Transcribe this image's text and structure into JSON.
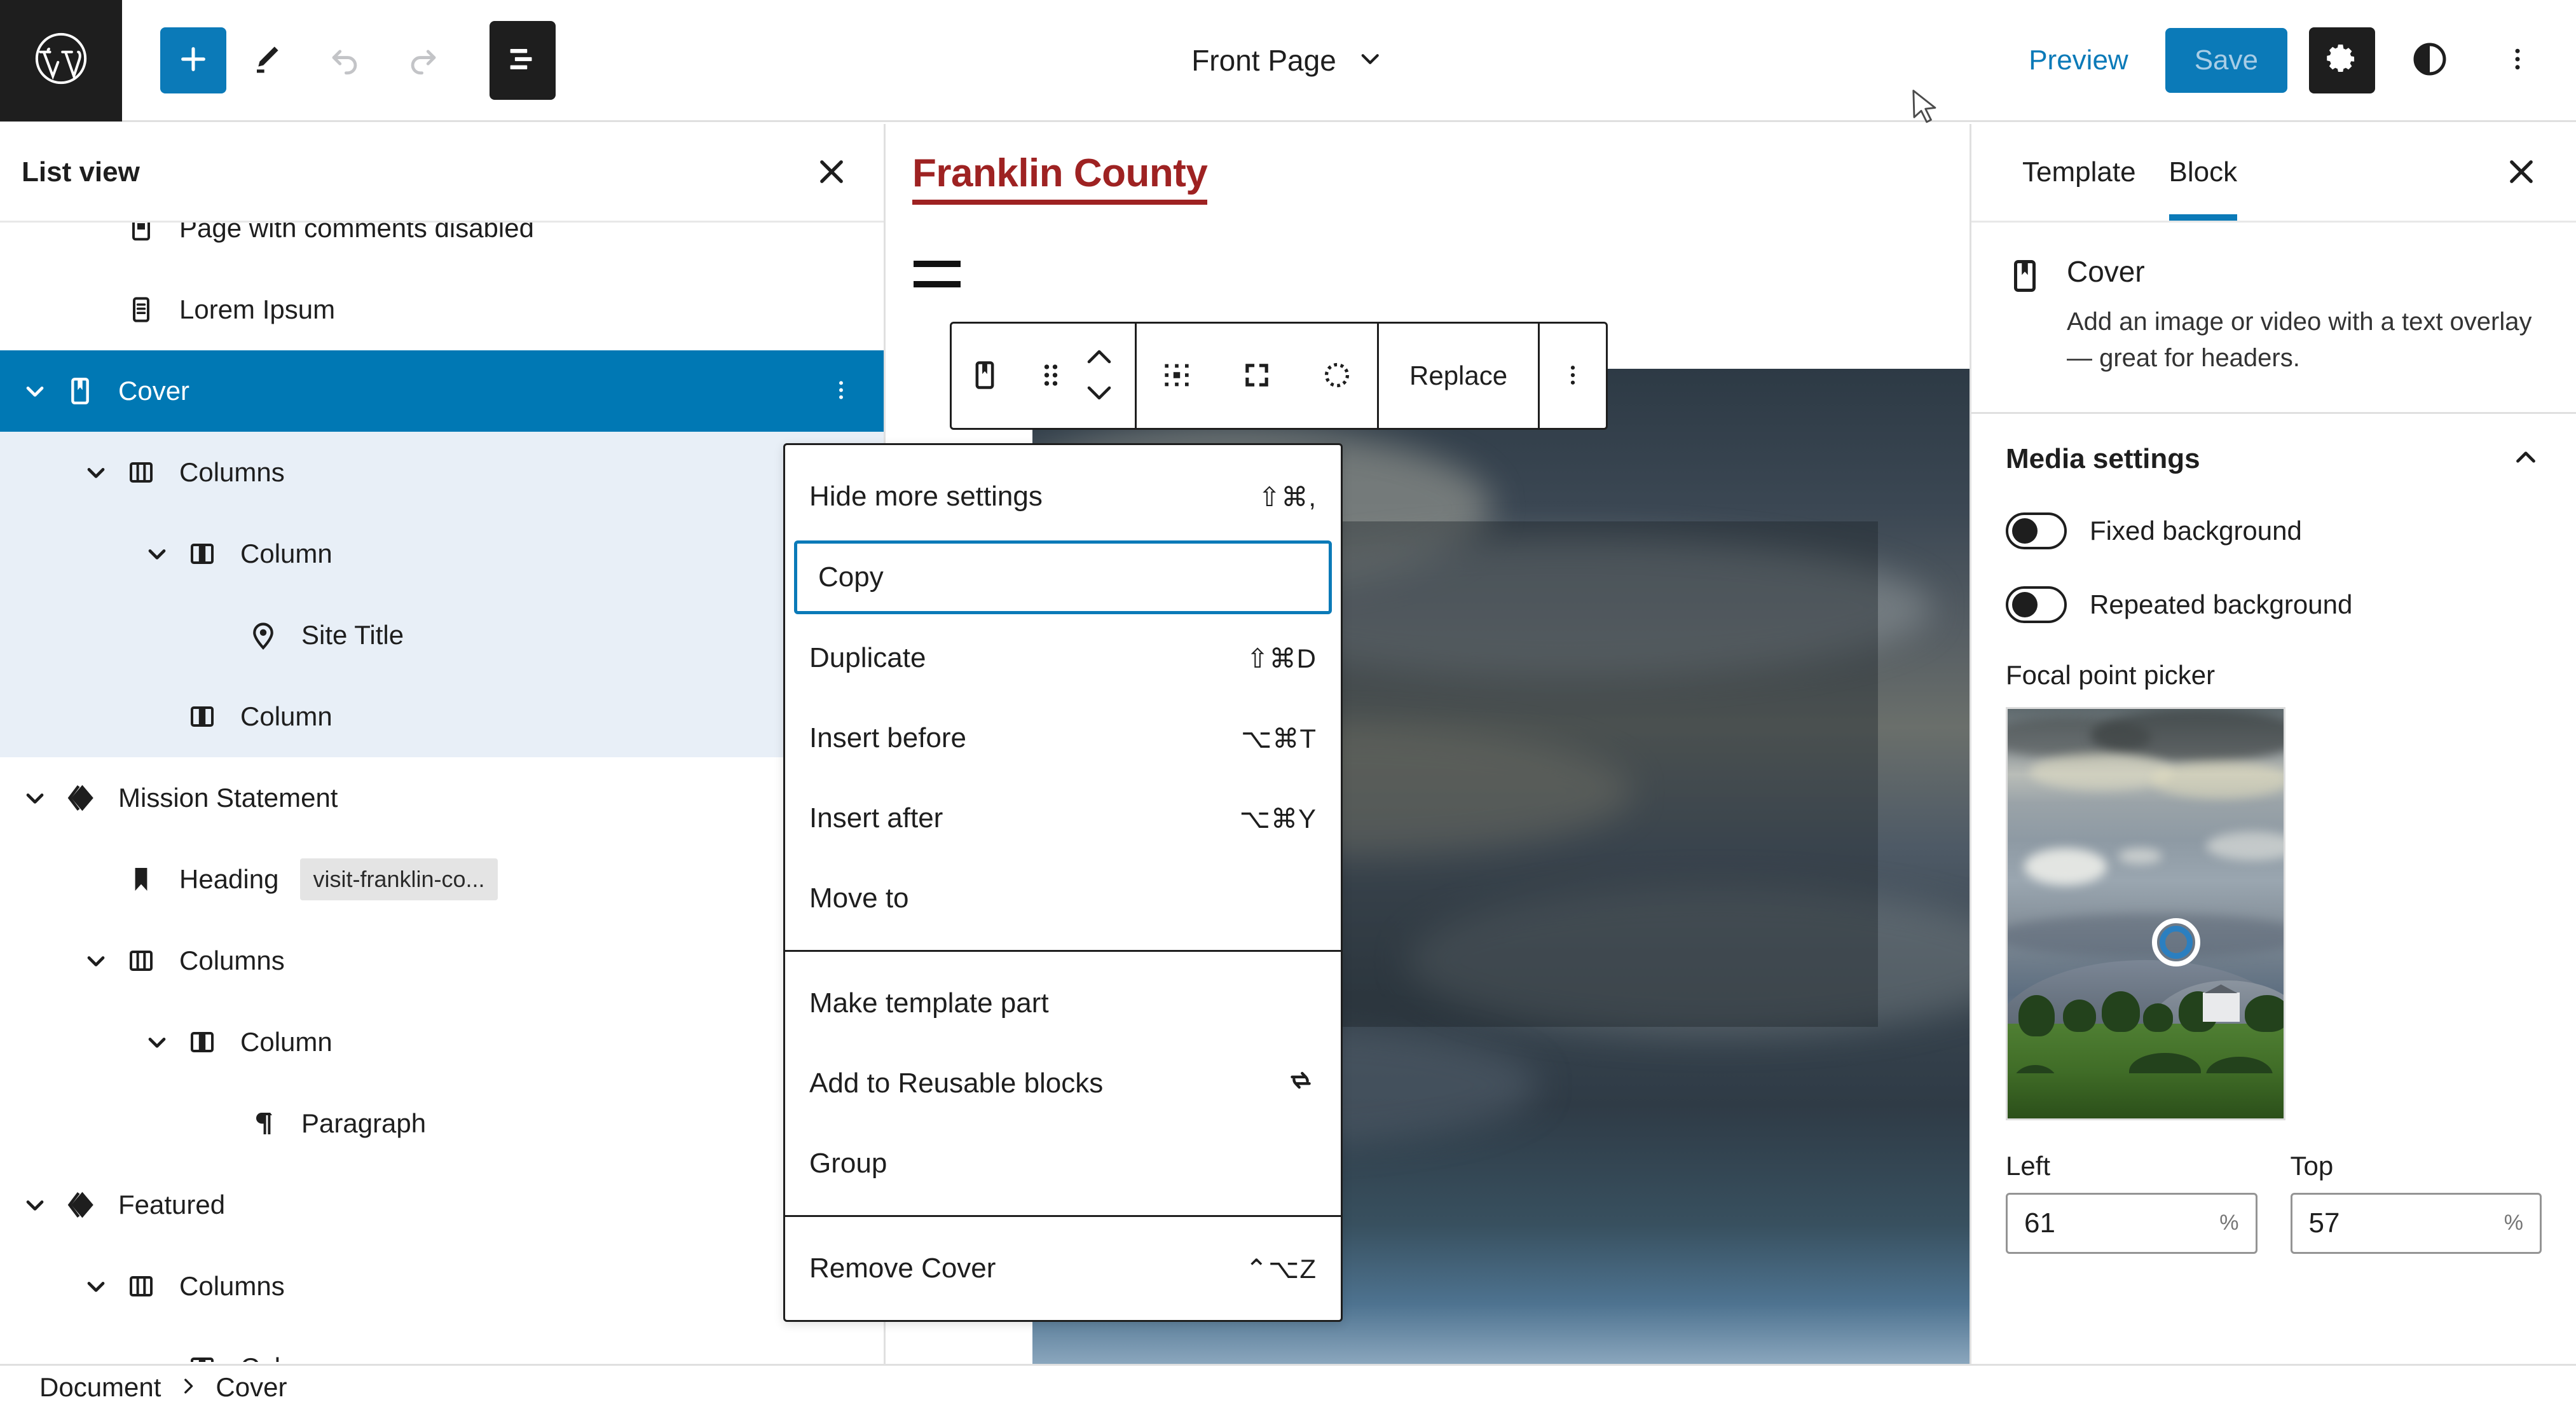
{
  "header": {
    "logo_icon": "wordpress-logo-icon",
    "add_block_icon": "plus-icon",
    "tools_icon": "pencil-icon",
    "undo_icon": "undo-arrow-icon",
    "redo_icon": "redo-arrow-icon",
    "listview_icon": "list-view-icon",
    "document_title": "Front Page",
    "document_chevron_icon": "chevron-down-icon",
    "preview_label": "Preview",
    "save_label": "Save",
    "settings_icon": "gear-icon",
    "styles_icon": "contrast-half-circle-icon",
    "options_icon": "vertical-ellipsis-icon"
  },
  "list_view": {
    "title": "List view",
    "close_icon": "close-x-icon",
    "rows": [
      {
        "label": "Page with comments disabled",
        "icon": "page-icon",
        "indent": 1,
        "chevron": "none",
        "state": "clipped"
      },
      {
        "label": "Lorem Ipsum",
        "icon": "post-icon",
        "indent": 1,
        "chevron": "none",
        "state": "normal"
      },
      {
        "label": "Cover",
        "icon": "cover-icon",
        "indent": 0,
        "chevron": "down",
        "state": "selected",
        "more_icon": "vertical-ellipsis-icon"
      },
      {
        "label": "Columns",
        "icon": "columns-icon",
        "indent": 1,
        "chevron": "down",
        "state": "child-highlight"
      },
      {
        "label": "Column",
        "icon": "column-icon",
        "indent": 2,
        "chevron": "down",
        "state": "child-highlight"
      },
      {
        "label": "Site Title",
        "icon": "map-pin-icon",
        "indent": 3,
        "chevron": "none",
        "state": "child-highlight"
      },
      {
        "label": "Column",
        "icon": "column-icon",
        "indent": 2,
        "chevron": "none",
        "state": "child-highlight"
      },
      {
        "label": "Mission Statement",
        "icon": "template-part-icon",
        "indent": 0,
        "chevron": "down",
        "state": "normal"
      },
      {
        "label": "Heading",
        "icon": "bookmark-icon",
        "indent": 1,
        "chevron": "none",
        "state": "normal",
        "anchor": "visit-franklin-co..."
      },
      {
        "label": "Columns",
        "icon": "columns-icon",
        "indent": 1,
        "chevron": "down",
        "state": "normal"
      },
      {
        "label": "Column",
        "icon": "column-icon",
        "indent": 2,
        "chevron": "down",
        "state": "normal"
      },
      {
        "label": "Paragraph",
        "icon": "paragraph-icon",
        "indent": 3,
        "chevron": "none",
        "state": "normal"
      },
      {
        "label": "Featured",
        "icon": "template-part-icon",
        "indent": 0,
        "chevron": "down",
        "state": "normal"
      },
      {
        "label": "Columns",
        "icon": "columns-icon",
        "indent": 1,
        "chevron": "down",
        "state": "normal"
      },
      {
        "label": "Column",
        "icon": "column-icon",
        "indent": 2,
        "chevron": "down",
        "state": "clipped"
      }
    ]
  },
  "canvas": {
    "site_title": "Franklin County",
    "nav_icon": "hamburger-menu-icon",
    "cover_heading_line1": "Franklin",
    "cover_heading_line2": "County"
  },
  "block_toolbar": {
    "block_icon": "cover-icon",
    "drag_icon": "drag-handle-icon",
    "move_up_icon": "chevron-up-icon",
    "move_down_icon": "chevron-down-icon",
    "align_icon": "change-alignment-icon",
    "fullwidth_icon": "full-width-icon",
    "content_position_icon": "content-position-dashed-circle-icon",
    "replace_label": "Replace",
    "more_icon": "vertical-ellipsis-icon"
  },
  "dropdown": {
    "groups": [
      [
        {
          "label": "Hide more settings",
          "shortcut": "⇧⌘,",
          "focused": false
        },
        {
          "label": "Copy",
          "shortcut": "",
          "focused": true
        },
        {
          "label": "Duplicate",
          "shortcut": "⇧⌘D",
          "focused": false
        },
        {
          "label": "Insert before",
          "shortcut": "⌥⌘T",
          "focused": false
        },
        {
          "label": "Insert after",
          "shortcut": "⌥⌘Y",
          "focused": false
        },
        {
          "label": "Move to",
          "shortcut": "",
          "focused": false
        }
      ],
      [
        {
          "label": "Make template part",
          "shortcut": "",
          "focused": false
        },
        {
          "label": "Add to Reusable blocks",
          "shortcut": "",
          "focused": false,
          "icon": "reusable-block-sync-icon"
        },
        {
          "label": "Group",
          "shortcut": "",
          "focused": false
        }
      ],
      [
        {
          "label": "Remove Cover",
          "shortcut": "⌃⌥Z",
          "focused": false
        }
      ]
    ]
  },
  "right_sidebar": {
    "tabs": [
      {
        "label": "Template",
        "active": false
      },
      {
        "label": "Block",
        "active": true
      }
    ],
    "close_icon": "close-x-icon",
    "block_icon": "cover-icon",
    "block_name": "Cover",
    "block_description": "Add an image or video with a text overlay — great for headers.",
    "panel": {
      "title": "Media settings",
      "collapse_icon": "chevron-up-icon",
      "toggles": [
        {
          "label": "Fixed background",
          "on": false
        },
        {
          "label": "Repeated background",
          "on": false
        }
      ],
      "focal_point_label": "Focal point picker",
      "focal_marker_icon": "focal-point-marker-icon",
      "inputs": [
        {
          "label": "Left",
          "value": "61",
          "unit": "%"
        },
        {
          "label": "Top",
          "value": "57",
          "unit": "%"
        }
      ]
    }
  },
  "breadcrumb": {
    "items": [
      "Document",
      "Cover"
    ],
    "separator_icon": "chevron-right-icon"
  },
  "colors": {
    "wp_blue": "#0b7ab8",
    "selected_row": "#0078b4",
    "child_row": "#e8eff7",
    "site_title_red": "#9e2222",
    "dark": "#1e1e1e"
  }
}
